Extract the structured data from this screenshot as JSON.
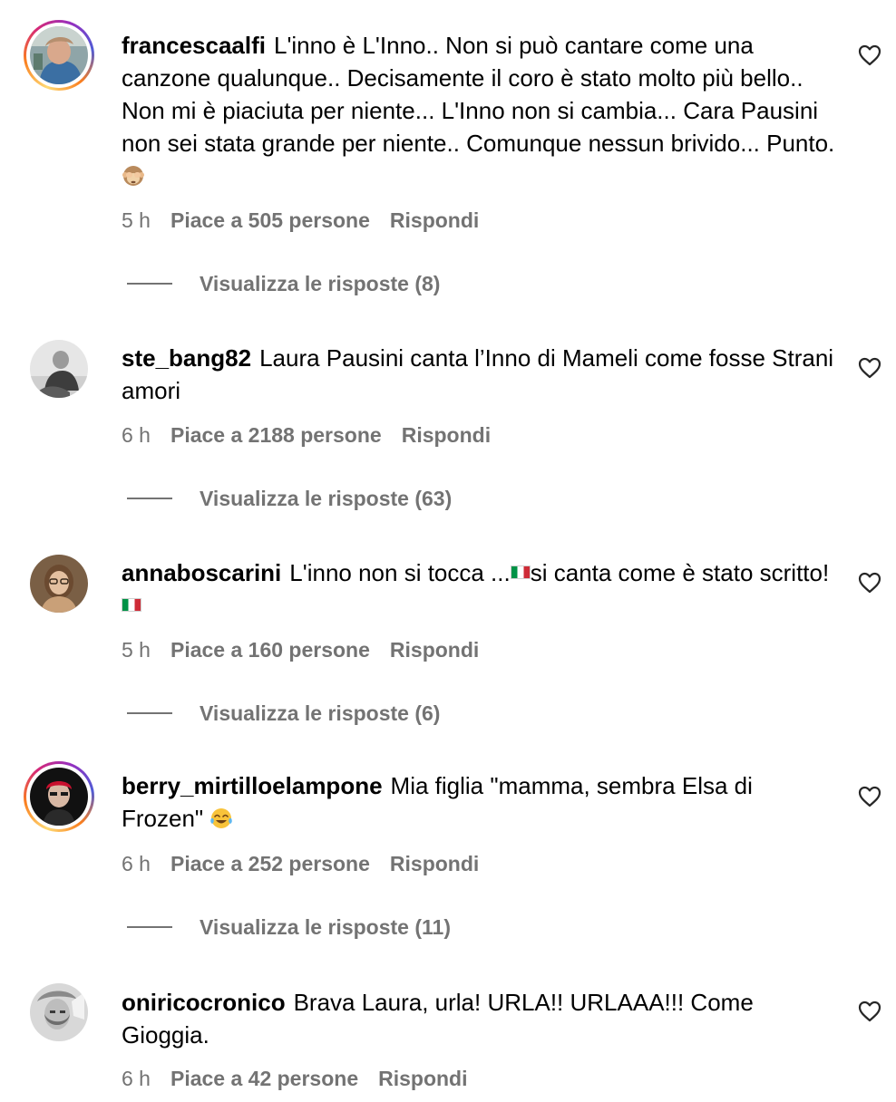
{
  "comments": [
    {
      "username": "francescaalfi",
      "text": "L'inno è L'Inno.. Non si può cantare come una canzone qualunque.. Decisamente il coro è stato molto più bello.. Non mi è piaciuta per niente... L'Inno non si cambia... Cara Pausini non sei stata grande per niente.. Comunque nessun brivido... Punto.",
      "time": "5 h",
      "likes": "Piace a 505 persone",
      "reply_label": "Rispondi",
      "view_replies": "Visualizza le risposte (8)",
      "avatar_icon": "profile-photo",
      "has_story_ring": true,
      "trailing_emoji": "see-no-evil-monkey-emoji"
    },
    {
      "username": "ste_bang82",
      "text": "Laura Pausini canta l’Inno di Mameli come fosse Strani amori",
      "time": "6 h",
      "likes": "Piace a 2188 persone",
      "reply_label": "Rispondi",
      "view_replies": "Visualizza le risposte (63)",
      "avatar_icon": "profile-photo",
      "has_story_ring": false
    },
    {
      "username": "annaboscarini",
      "text_part1": "L'inno non si tocca ...",
      "text_part2": "si canta come è stato scritto!",
      "time": "5 h",
      "likes": "Piace a 160 persone",
      "reply_label": "Rispondi",
      "view_replies": "Visualizza le risposte (6)",
      "avatar_icon": "profile-photo",
      "has_story_ring": false,
      "inline_emoji": "italy-flag-emoji"
    },
    {
      "username": "berry_mirtilloelampone",
      "text": "Mia figlia \"mamma, sembra Elsa di Frozen\"",
      "time": "6 h",
      "likes": "Piace a 252 persone",
      "reply_label": "Rispondi",
      "view_replies": "Visualizza le risposte (11)",
      "avatar_icon": "profile-photo",
      "has_story_ring": true,
      "trailing_emoji": "tears-of-joy-emoji"
    },
    {
      "username": "oniricocronico",
      "text": "Brava Laura, urla! URLA!! URLAAA!!! Come Gioggia.",
      "time": "6 h",
      "likes": "Piace a 42 persone",
      "reply_label": "Rispondi",
      "avatar_icon": "profile-photo",
      "has_story_ring": false
    }
  ],
  "colors": {
    "text": "#000000",
    "muted": "#737373",
    "background": "#ffffff"
  },
  "icons": {
    "like": "heart-icon"
  }
}
